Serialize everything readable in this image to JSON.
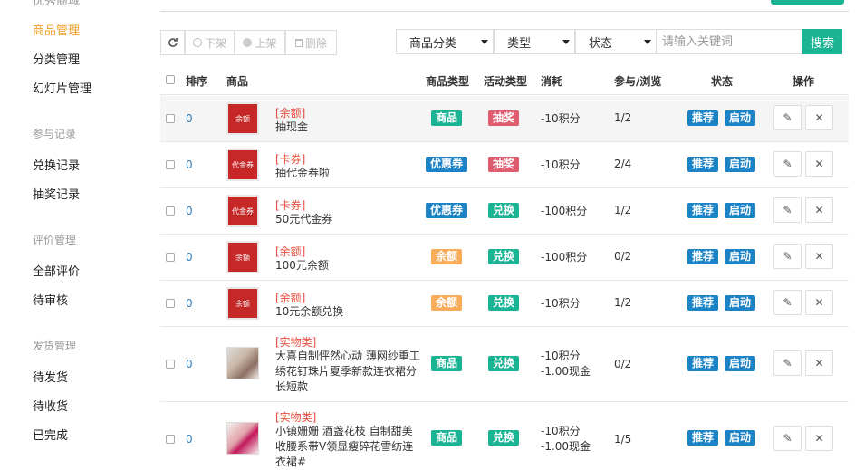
{
  "sidebar": {
    "cut_heading": "优秀商城",
    "items_top": [
      {
        "label": "商品管理",
        "active": true
      },
      {
        "label": "分类管理"
      },
      {
        "label": "幻灯片管理"
      }
    ],
    "group_participation": "参与记录",
    "items_participation": [
      {
        "label": "兑换记录"
      },
      {
        "label": "抽奖记录"
      }
    ],
    "group_review": "评价管理",
    "items_review": [
      {
        "label": "全部评价"
      },
      {
        "label": "待审核"
      }
    ],
    "group_shipping": "发货管理",
    "items_shipping": [
      {
        "label": "待发货"
      },
      {
        "label": "待收货"
      },
      {
        "label": "已完成"
      }
    ]
  },
  "toolbar": {
    "offline": "下架",
    "online": "上架",
    "delete": "删除",
    "filter_category": "商品分类",
    "filter_type": "类型",
    "filter_status": "状态",
    "search_placeholder": "请输入关键词",
    "search_button": "搜索"
  },
  "table": {
    "headers": {
      "sort": "排序",
      "product": "商品",
      "product_type": "商品类型",
      "activity_type": "活动类型",
      "cost": "消耗",
      "join_view": "参与/浏览",
      "status": "状态",
      "actions": "操作"
    },
    "rows": [
      {
        "sort": "0",
        "category": "[余额]",
        "name": "抽现金",
        "product_type": "商品",
        "activity_type": "抽奖",
        "cost1": "-10积分",
        "cost2": "",
        "ratio": "1/2",
        "status1": "推荐",
        "status2": "启动"
      },
      {
        "sort": "0",
        "category": "[卡券]",
        "name": "抽代金券啦",
        "product_type": "优惠券",
        "activity_type": "抽奖",
        "cost1": "-10积分",
        "cost2": "",
        "ratio": "2/4",
        "status1": "推荐",
        "status2": "启动"
      },
      {
        "sort": "0",
        "category": "[卡券]",
        "name": "50元代金券",
        "product_type": "优惠券",
        "activity_type": "兑换",
        "cost1": "-100积分",
        "cost2": "",
        "ratio": "1/2",
        "status1": "推荐",
        "status2": "启动"
      },
      {
        "sort": "0",
        "category": "[余额]",
        "name": "100元余额",
        "product_type": "余额",
        "activity_type": "兑换",
        "cost1": "-100积分",
        "cost2": "",
        "ratio": "0/2",
        "status1": "推荐",
        "status2": "启动"
      },
      {
        "sort": "0",
        "category": "[余额]",
        "name": "10元余额兑换",
        "product_type": "余额",
        "activity_type": "兑换",
        "cost1": "-10积分",
        "cost2": "",
        "ratio": "1/2",
        "status1": "推荐",
        "status2": "启动"
      },
      {
        "sort": "0",
        "category": "[实物类]",
        "name": "大喜自制怦然心动 薄网纱重工绣花钉珠片夏季新款连衣裙分长短款",
        "product_type": "商品",
        "activity_type": "兑换",
        "cost1": "-10积分",
        "cost2": "-1.00现金",
        "ratio": "0/2",
        "status1": "推荐",
        "status2": "启动"
      },
      {
        "sort": "0",
        "category": "[实物类]",
        "name": "小镇姗姗 酒盏花枝 自制甜美收腰系带V领显瘦碎花雪纺连衣裙#",
        "product_type": "商品",
        "activity_type": "兑换",
        "cost1": "-10积分",
        "cost2": "-1.00现金",
        "ratio": "1/5",
        "status1": "推荐",
        "status2": "启动"
      }
    ],
    "thumb_text": {
      "cash": "余额",
      "voucher": "代金券"
    }
  },
  "colors": {
    "accent": "#1ab394",
    "active_nav": "#f0a02b",
    "badge_red": "#e05d6f",
    "badge_blue": "#1c84c6",
    "badge_orange": "#f8ac59"
  }
}
